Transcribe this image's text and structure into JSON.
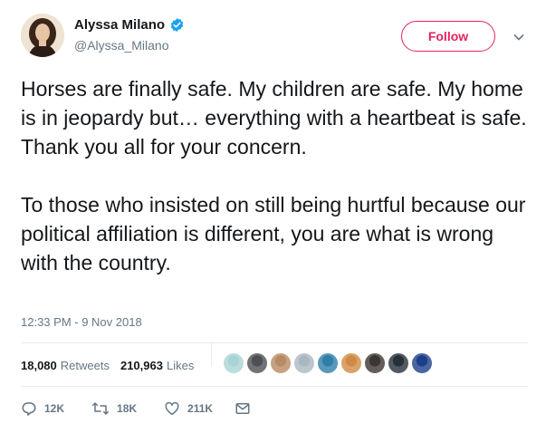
{
  "user": {
    "display_name": "Alyssa Milano",
    "handle": "@Alyssa_Milano",
    "verified": true
  },
  "follow_label": "Follow",
  "tweet": {
    "paragraphs": [
      "Horses are finally safe. My children are safe. My home is in jeopardy but… everything with a heartbeat is safe. Thank you all for your concern.",
      "To those who insisted on still being hurtful because our political affiliation is different, you are what is wrong with the country."
    ],
    "timestamp": "12:33 PM - 9 Nov 2018"
  },
  "stats": {
    "retweets_count": "18,080",
    "retweets_label": "Retweets",
    "likes_count": "210,963",
    "likes_label": "Likes"
  },
  "likers": [
    {
      "color": "#a9d4d6"
    },
    {
      "color": "#4d4f52"
    },
    {
      "color": "#b88a64"
    },
    {
      "color": "#aab8c2"
    },
    {
      "color": "#2f7ea8"
    },
    {
      "color": "#d18a45"
    },
    {
      "color": "#3b3533"
    },
    {
      "color": "#27313a"
    },
    {
      "color": "#1c3f8c"
    }
  ],
  "actions": {
    "reply_count": "12K",
    "retweet_count": "18K",
    "like_count": "211K"
  },
  "colors": {
    "accent": "#e0245e",
    "verified": "#1da1f2",
    "secondary_text": "#657786"
  }
}
